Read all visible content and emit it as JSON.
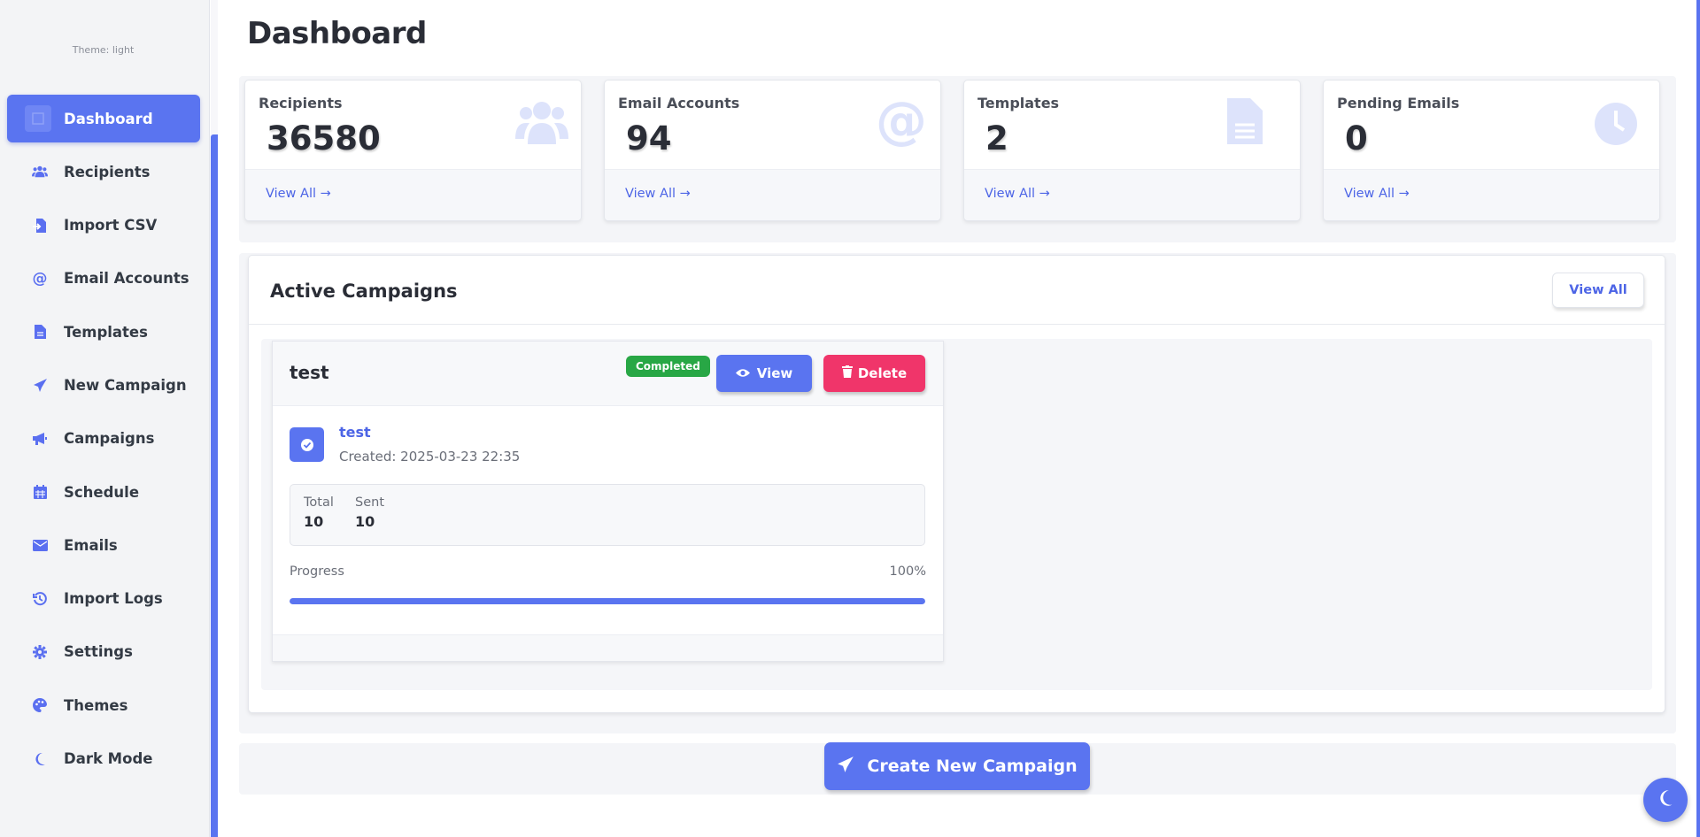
{
  "sidebar": {
    "theme_label": "Theme: light",
    "items": [
      {
        "label": "Dashboard",
        "icon": "chart-icon",
        "active": true
      },
      {
        "label": "Recipients",
        "icon": "users-icon"
      },
      {
        "label": "Import CSV",
        "icon": "file-import-icon"
      },
      {
        "label": "Email Accounts",
        "icon": "at-icon"
      },
      {
        "label": "Templates",
        "icon": "file-icon"
      },
      {
        "label": "New Campaign",
        "icon": "paper-plane-icon"
      },
      {
        "label": "Campaigns",
        "icon": "bullhorn-icon"
      },
      {
        "label": "Schedule",
        "icon": "calendar-icon"
      },
      {
        "label": "Emails",
        "icon": "envelope-icon"
      },
      {
        "label": "Import Logs",
        "icon": "history-icon"
      },
      {
        "label": "Settings",
        "icon": "gear-icon"
      },
      {
        "label": "Themes",
        "icon": "palette-icon"
      },
      {
        "label": "Dark Mode",
        "icon": "moon-icon"
      }
    ]
  },
  "page": {
    "title": "Dashboard"
  },
  "stats": [
    {
      "title": "Recipients",
      "value": "36580",
      "link": "View All →",
      "icon": "users-icon"
    },
    {
      "title": "Email Accounts",
      "value": "94",
      "link": "View All →",
      "icon": "at-icon"
    },
    {
      "title": "Templates",
      "value": "2",
      "link": "View All →",
      "icon": "file-icon"
    },
    {
      "title": "Pending Emails",
      "value": "0",
      "link": "View All →",
      "icon": "clock-icon"
    }
  ],
  "active_campaigns": {
    "title": "Active Campaigns",
    "view_all_label": "View All",
    "campaign": {
      "name": "test",
      "status": "Completed",
      "view_label": "View",
      "delete_label": "Delete",
      "link": "test",
      "created": "Created: 2025-03-23 22:35",
      "total_label": "Total",
      "total_value": "10",
      "sent_label": "Sent",
      "sent_value": "10",
      "progress_label": "Progress",
      "progress_pct": "100%",
      "progress_fraction": 1.0
    }
  },
  "create_button_label": "Create New Campaign",
  "colors": {
    "primary": "#5a74f0",
    "danger": "#f0356a",
    "success": "#28a745"
  }
}
